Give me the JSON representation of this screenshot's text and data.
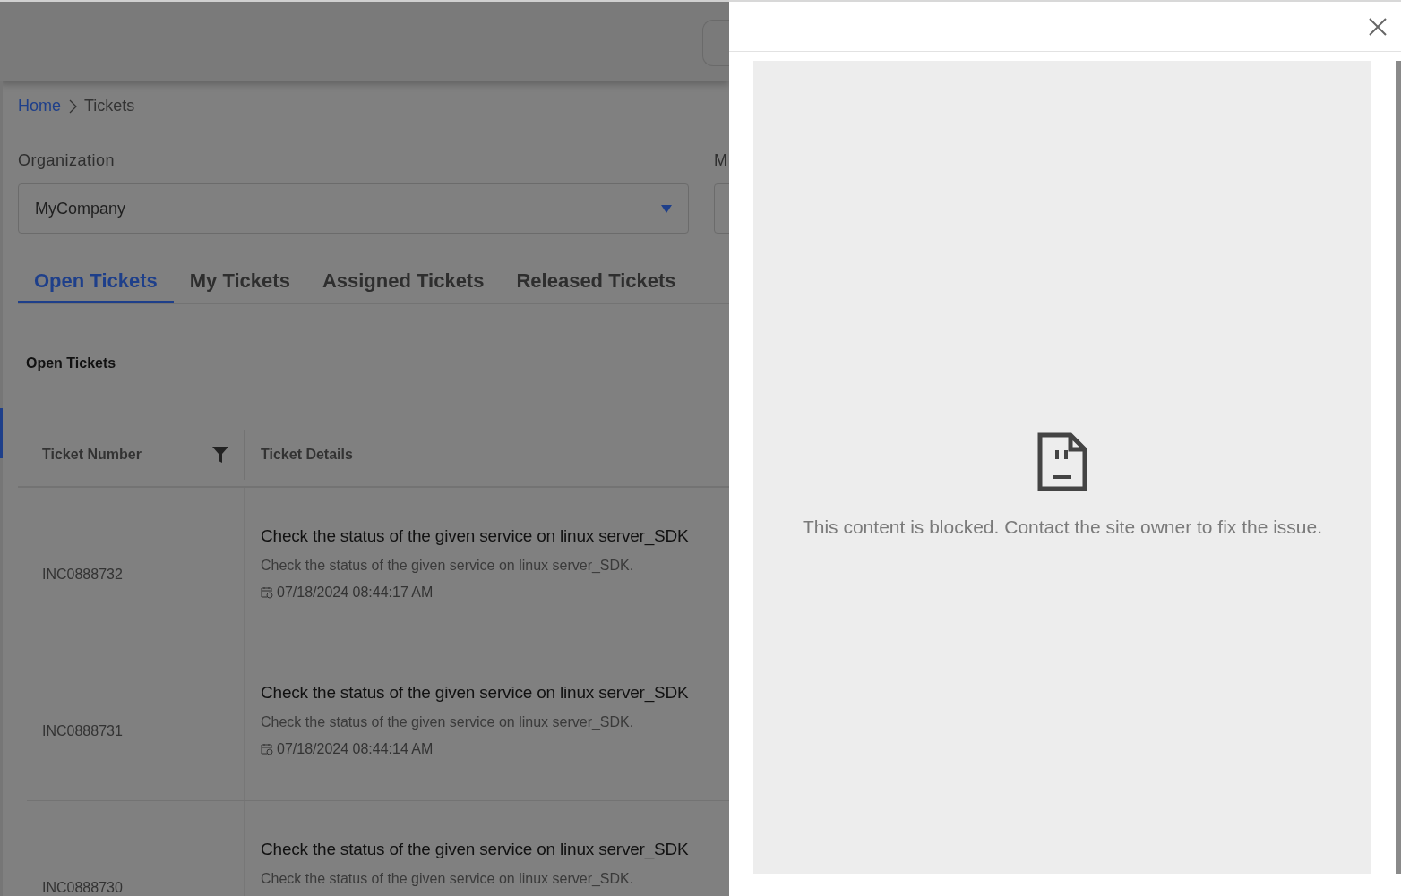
{
  "breadcrumb": [
    {
      "label": "Home",
      "link": true
    },
    {
      "label": "Tickets",
      "link": false
    }
  ],
  "filters": [
    {
      "label": "Organization",
      "value": "MyCompany"
    },
    {
      "label": "M"
    }
  ],
  "tabs": [
    {
      "label": "Open Tickets",
      "selected": true
    },
    {
      "label": "My Tickets",
      "selected": false
    },
    {
      "label": "Assigned Tickets",
      "selected": false
    },
    {
      "label": "Released Tickets",
      "selected": false
    }
  ],
  "section_title": "Open Tickets",
  "table": {
    "columns": [
      "Ticket Number",
      "Ticket Details"
    ],
    "rows": [
      {
        "number": "INC0888732",
        "title": "Check the status of the given service on linux server_SDK",
        "description": "Check the status of the given service on linux server_SDK.",
        "date": "07/18/2024 08:44:17 AM"
      },
      {
        "number": "INC0888731",
        "title": "Check the status of the given service on linux server_SDK",
        "description": "Check the status of the given service on linux server_SDK.",
        "date": "07/18/2024 08:44:14 AM"
      },
      {
        "number": "INC0888730",
        "title": "Check the status of the given service on linux server_SDK",
        "description": "Check the status of the given service on linux server_SDK."
      }
    ]
  },
  "panel": {
    "message": "This content is blocked. Contact the site owner to fix the issue."
  }
}
